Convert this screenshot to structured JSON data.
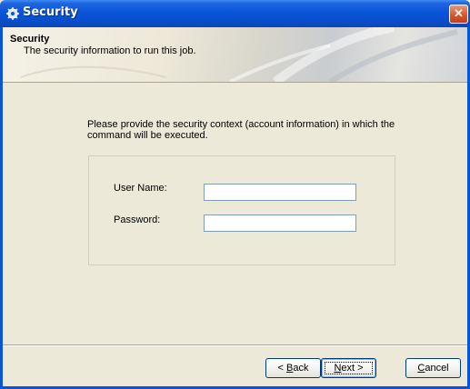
{
  "window": {
    "title": "Security",
    "icon": "gear-app-icon",
    "close_label": "✕"
  },
  "header": {
    "title": "Security",
    "subtitle": "The security information to run this job."
  },
  "main": {
    "intro": "Please provide the security context (account information) in which the command will be executed.",
    "fields": {
      "username": {
        "label": "User Name:",
        "value": ""
      },
      "password": {
        "label": "Password:",
        "value": ""
      }
    }
  },
  "footer": {
    "back": {
      "prefix": "< ",
      "mnemonic": "B",
      "rest": "ack"
    },
    "next": {
      "mnemonic": "N",
      "rest": "ext >"
    },
    "cancel": {
      "mnemonic": "C",
      "rest": "ancel"
    }
  },
  "colors": {
    "titlebar": "#0A54D8",
    "dialog_bg": "#ECE9D8",
    "input_border": "#7F9DB9",
    "close_button": "#D9562E"
  }
}
